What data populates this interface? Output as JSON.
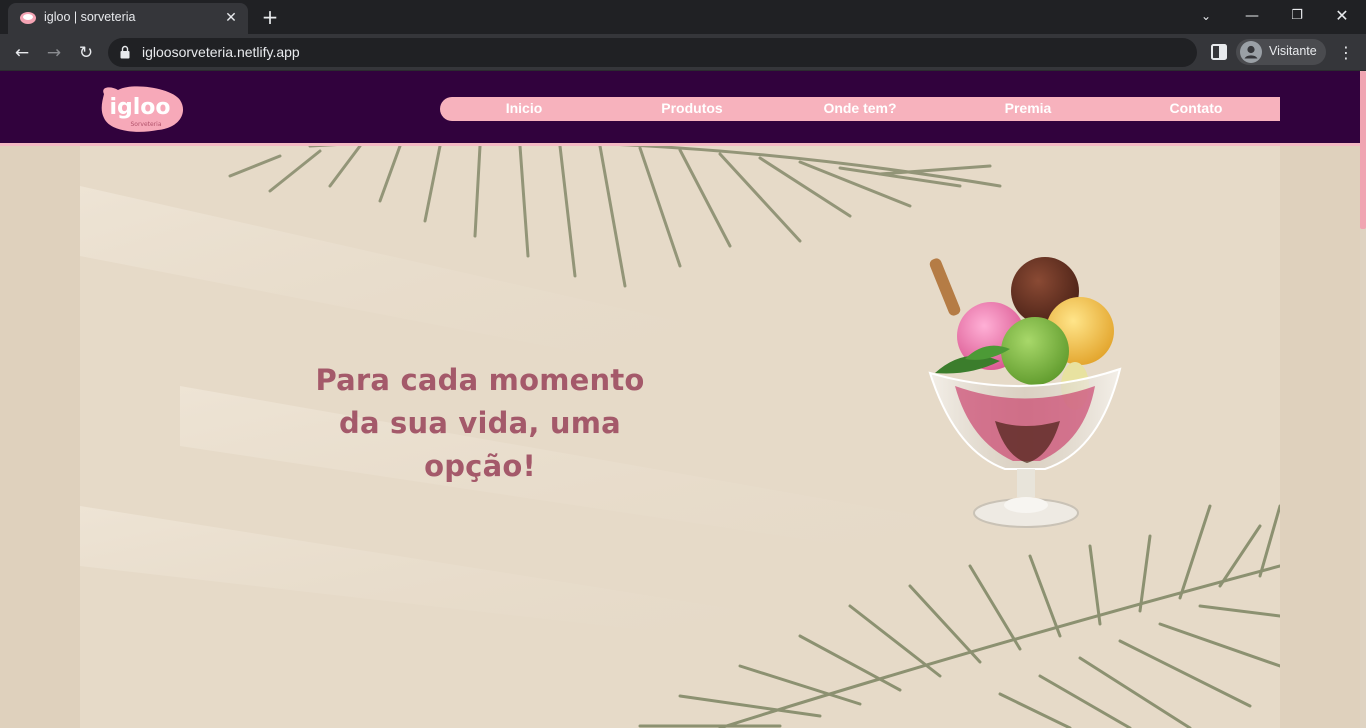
{
  "browser": {
    "tab_title": "igloo | sorveteria",
    "url": "igloosorveteria.netlify.app",
    "profile_label": "Visitante"
  },
  "site": {
    "logo_text": "igloo",
    "logo_subtext": "Sorveteria",
    "nav": [
      "Inicio",
      "Produtos",
      "Onde tem?",
      "Premia",
      "Contato"
    ],
    "headline_line1": "Para cada momento",
    "headline_line2": "da sua vida, uma opção!"
  },
  "colors": {
    "header_bg": "#31023d",
    "nav_bg": "#f7b2bd",
    "headline": "#a4596a",
    "hero_bg": "#e7dccb"
  },
  "icons": [
    "back-arrow-icon",
    "forward-arrow-icon",
    "reload-icon",
    "lock-icon",
    "side-panel-icon",
    "profile-avatar-icon",
    "kebab-menu-icon",
    "tab-search-icon",
    "minimize-icon",
    "restore-icon",
    "close-window-icon",
    "new-tab-icon",
    "close-tab-icon"
  ]
}
